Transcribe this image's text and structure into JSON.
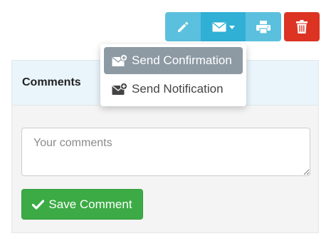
{
  "toolbar": {
    "edit_icon": "pencil-icon",
    "email_icon": "envelope-icon",
    "print_icon": "printer-icon",
    "delete_icon": "trash-icon"
  },
  "email_menu": {
    "items": [
      {
        "label": "Send Confirmation",
        "icon": "envelope-plus-icon",
        "active": true
      },
      {
        "label": "Send Notification",
        "icon": "envelope-plus-icon",
        "active": false
      }
    ]
  },
  "comments": {
    "title": "Comments",
    "placeholder": "Your comments",
    "value": "",
    "save_label": "Save Comment"
  },
  "colors": {
    "info": "#5bc0de",
    "info_active": "#31b0d5",
    "danger": "#dd3322",
    "success": "#3cab45",
    "menu_active": "#8d9aa4"
  }
}
